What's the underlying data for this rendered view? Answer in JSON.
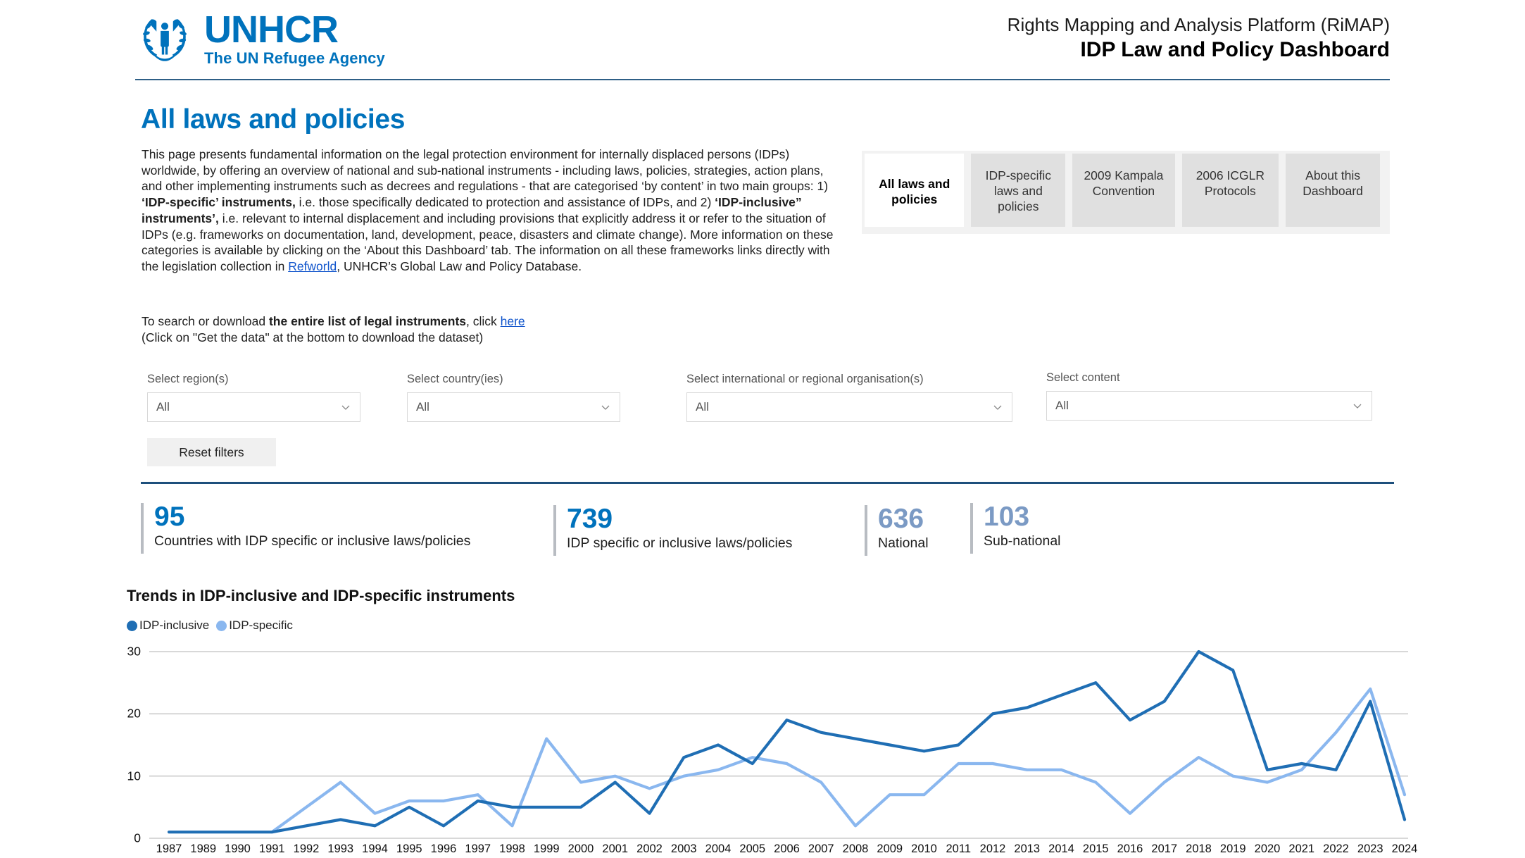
{
  "header": {
    "logo_name": "unhcr-logo",
    "logo_title": "UNHCR",
    "logo_subtitle": "The UN Refugee Agency",
    "platform": "Rights Mapping and Analysis Platform (RiMAP)",
    "dashboard_title": "IDP Law and Policy Dashboard"
  },
  "page": {
    "title": "All laws and policies",
    "intro_parts": {
      "p1": "This page presents fundamental information on the legal protection environment for internally displaced persons (IDPs) worldwide, by offering an overview of national and sub-national instruments - including laws, policies, strategies, action plans, and other implementing instruments such as decrees and regulations - that are categorised ‘by content’ in two main groups: 1) ",
      "b1": "‘IDP-specific’ instruments,",
      "p2": " i.e. those specifically dedicated to protection and assistance of IDPs, and 2) ",
      "b2": "‘IDP-inclusive” instruments’,",
      "p3": " i.e. relevant to internal displacement and including provisions that explicitly address it or refer to the situation of IDPs (e.g. frameworks on documentation, land, development, peace, disasters and climate change). More information on these categories is available by clicking on the ‘About this Dashboard’ tab. The information on all these frameworks links directly with the legislation collection in ",
      "link_refworld": "Refworld",
      "p4": ", UNHCR’s Global Law and Policy Database."
    },
    "search_note": {
      "s1": "To search or download ",
      "b1": "the entire list of legal instruments",
      "s2": ", click ",
      "link_here": "here",
      "s3": "(Click on \"Get the data\" at the bottom to download the dataset)"
    }
  },
  "tabs": [
    {
      "label": "All laws and policies",
      "active": true
    },
    {
      "label": "IDP-specific laws and policies",
      "active": false
    },
    {
      "label": "2009 Kampala Convention",
      "active": false
    },
    {
      "label": "2006 ICGLR Protocols",
      "active": false
    },
    {
      "label": "About this Dashboard",
      "active": false
    }
  ],
  "filters": [
    {
      "label": "Select region(s)",
      "value": "All"
    },
    {
      "label": "Select country(ies)",
      "value": "All"
    },
    {
      "label": "Select international or regional organisation(s)",
      "value": "All"
    },
    {
      "label": "Select content",
      "value": "All"
    }
  ],
  "reset_button": "Reset filters",
  "kpis": [
    {
      "value": "95",
      "label": "Countries with IDP specific or inclusive laws/policies",
      "muted": false
    },
    {
      "value": "739",
      "label": "IDP specific or inclusive laws/policies",
      "muted": false
    },
    {
      "value": "636",
      "label": "National",
      "muted": true
    },
    {
      "value": "103",
      "label": "Sub-national",
      "muted": true
    }
  ],
  "colors": {
    "brand_blue": "#0072bc",
    "idp_inclusive": "#1f6eb4",
    "idp_specific": "#8ab7ef",
    "muted_blue": "#7b9ac4",
    "divider": "#1d4f7c"
  },
  "chart_data": {
    "type": "line",
    "title": "Trends in IDP-inclusive and IDP-specific instruments",
    "xlabel": "",
    "ylabel": "",
    "ylim": [
      0,
      30
    ],
    "yticks": [
      0,
      10,
      20,
      30
    ],
    "grid": true,
    "legend_position": "top-left",
    "categories": [
      "1987",
      "1989",
      "1990",
      "1991",
      "1992",
      "1993",
      "1994",
      "1995",
      "1996",
      "1997",
      "1998",
      "1999",
      "2000",
      "2001",
      "2002",
      "2003",
      "2004",
      "2005",
      "2006",
      "2007",
      "2008",
      "2009",
      "2010",
      "2011",
      "2012",
      "2013",
      "2014",
      "2015",
      "2016",
      "2017",
      "2018",
      "2019",
      "2020",
      "2021",
      "2022",
      "2023",
      "2024"
    ],
    "series": [
      {
        "name": "IDP-inclusive",
        "color": "#1f6eb4",
        "values": [
          1,
          1,
          1,
          1,
          2,
          3,
          2,
          5,
          2,
          6,
          5,
          5,
          5,
          9,
          4,
          13,
          15,
          12,
          19,
          17,
          16,
          15,
          14,
          15,
          20,
          21,
          23,
          25,
          19,
          22,
          30,
          27,
          11,
          12,
          11,
          22,
          3
        ]
      },
      {
        "name": "IDP-specific",
        "color": "#8ab7ef",
        "values": [
          null,
          null,
          null,
          1,
          5,
          9,
          4,
          6,
          6,
          7,
          2,
          16,
          9,
          10,
          8,
          10,
          11,
          13,
          12,
          9,
          2,
          7,
          7,
          12,
          12,
          11,
          11,
          9,
          4,
          9,
          13,
          10,
          9,
          11,
          17,
          24,
          7
        ]
      }
    ]
  }
}
